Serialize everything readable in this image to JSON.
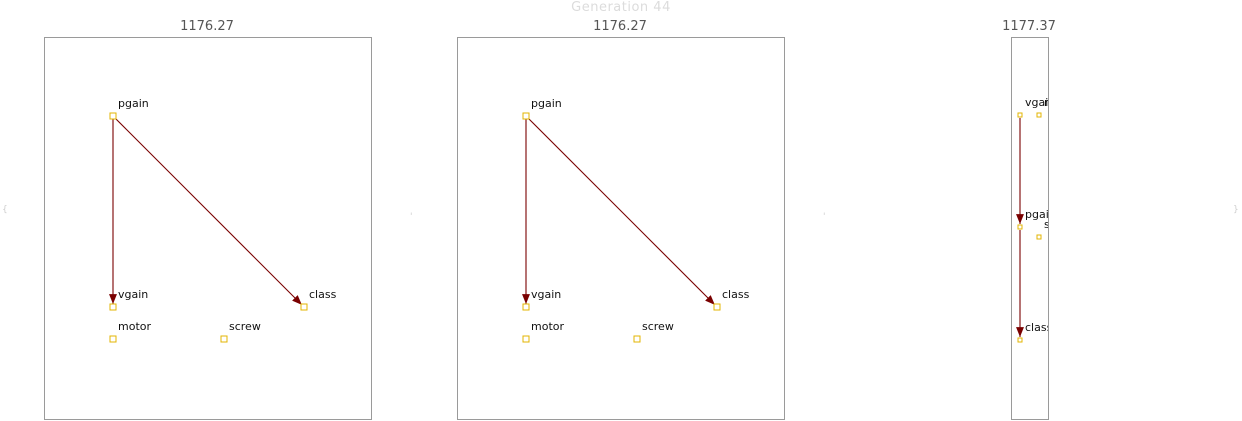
{
  "generation": {
    "title": "Generation 44"
  },
  "panels": [
    {
      "score": "1176.27",
      "nodes": [
        {
          "id": "pgain",
          "label": "pgain"
        },
        {
          "id": "vgain",
          "label": "vgain"
        },
        {
          "id": "class",
          "label": "class"
        },
        {
          "id": "motor",
          "label": "motor"
        },
        {
          "id": "screw",
          "label": "screw"
        }
      ],
      "edges": [
        {
          "from": "pgain",
          "to": "vgain"
        },
        {
          "from": "pgain",
          "to": "class"
        }
      ]
    },
    {
      "score": "1176.27",
      "nodes": [
        {
          "id": "pgain",
          "label": "pgain"
        },
        {
          "id": "vgain",
          "label": "vgain"
        },
        {
          "id": "class",
          "label": "class"
        },
        {
          "id": "motor",
          "label": "motor"
        },
        {
          "id": "screw",
          "label": "screw"
        }
      ],
      "edges": [
        {
          "from": "pgain",
          "to": "vgain"
        },
        {
          "from": "pgain",
          "to": "class"
        }
      ]
    },
    {
      "score": "1177.37",
      "nodes": [
        {
          "id": "vgain",
          "label": "vgain"
        },
        {
          "id": "motor",
          "label": "motor"
        },
        {
          "id": "pgain",
          "label": "pgain"
        },
        {
          "id": "screw",
          "label": "screw"
        },
        {
          "id": "class",
          "label": "class"
        }
      ],
      "edges": [
        {
          "from": "vgain",
          "to": "pgain"
        },
        {
          "from": "pgain",
          "to": "class"
        }
      ]
    }
  ],
  "colors": {
    "edge": "#7a0000",
    "node_border": "#e3b400",
    "panel_border": "#9a9a9a"
  }
}
